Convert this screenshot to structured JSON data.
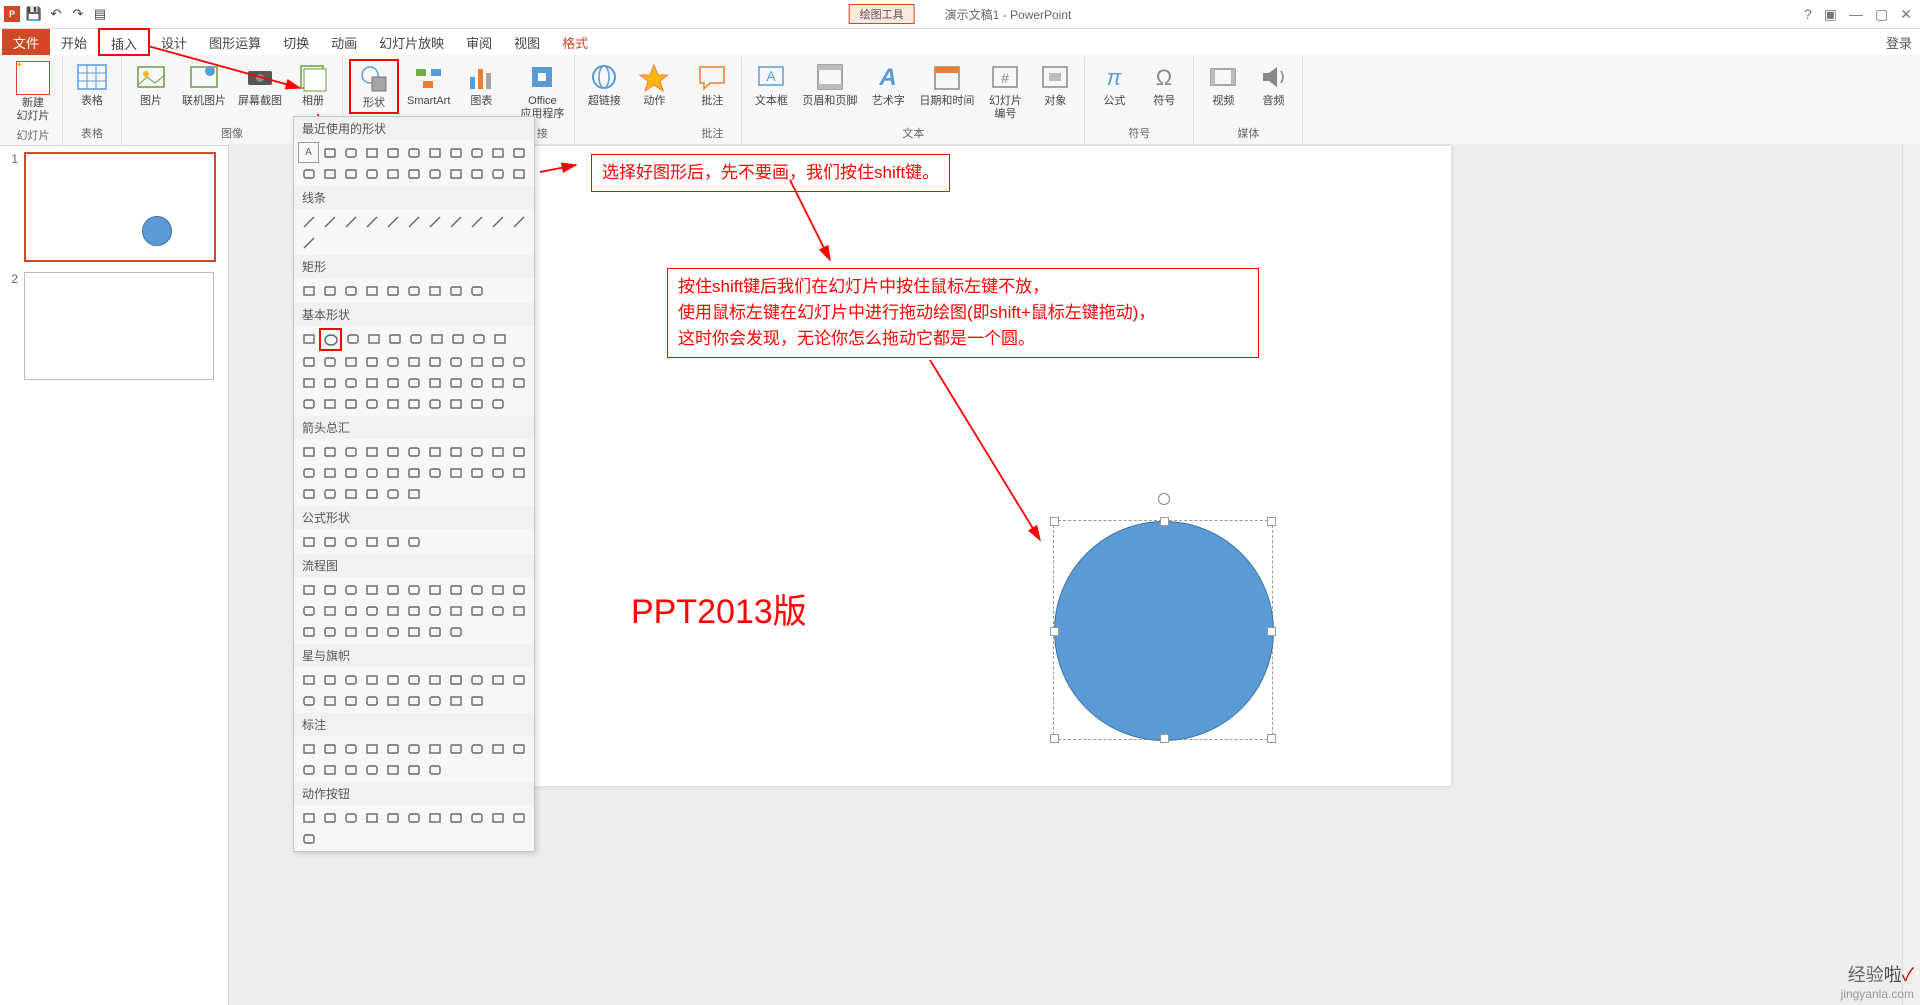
{
  "titlebar": {
    "contextual": "绘图工具",
    "doc_title": "演示文稿1 - PowerPoint",
    "help": "?"
  },
  "tabs": {
    "file": "文件",
    "home": "开始",
    "insert": "插入",
    "design": "设计",
    "tuxing": "图形运算",
    "transitions": "切换",
    "animations": "动画",
    "slideshow": "幻灯片放映",
    "review": "审阅",
    "view": "视图",
    "format": "格式",
    "login": "登录"
  },
  "ribbon": {
    "slides": {
      "new_slide": "新建\n幻灯片",
      "label": "幻灯片"
    },
    "tables": {
      "table": "表格",
      "label": "表格"
    },
    "images": {
      "picture": "图片",
      "online_pic": "联机图片",
      "screenshot": "屏幕截图",
      "album": "相册",
      "label": "图像"
    },
    "illustrations": {
      "shapes": "形状",
      "smartart": "SmartArt",
      "chart": "图表"
    },
    "apps": {
      "office_apps": "Office\n应用程序",
      "label": "接"
    },
    "links": {
      "hyperlink": "超链接",
      "action": "动作"
    },
    "comments": {
      "comment": "批注",
      "label": "批注"
    },
    "text": {
      "textbox": "文本框",
      "header_footer": "页眉和页脚",
      "wordart": "艺术字",
      "date_time": "日期和时间",
      "slide_num": "幻灯片\n编号",
      "object": "对象",
      "label": "文本"
    },
    "symbols": {
      "equation": "公式",
      "symbol": "符号",
      "label": "符号"
    },
    "media": {
      "video": "视频",
      "audio": "音频",
      "label": "媒体"
    }
  },
  "shape_dropdown": {
    "recent": "最近使用的形状",
    "lines": "线条",
    "rectangles": "矩形",
    "basic": "基本形状",
    "arrows": "箭头总汇",
    "equation": "公式形状",
    "flowchart": "流程图",
    "stars": "星与旗帜",
    "callouts": "标注",
    "action": "动作按钮"
  },
  "thumbs": {
    "s1": "1",
    "s2": "2"
  },
  "annotations": {
    "callout1": "选择好图形后，先不要画，我们按住shift键。",
    "callout2_l1": "按住shift键后我们在幻灯片中按住鼠标左键不放，",
    "callout2_l2": "使用鼠标左键在幻灯片中进行拖动绘图(即shift+鼠标左键拖动)，",
    "callout2_l3": "这时你会发现，无论你怎么拖动它都是一个圆。",
    "version": "PPT2013版"
  },
  "watermark": {
    "l1_a": "经验",
    "l1_b": "啦",
    "l1_c": "✓",
    "l2": "jingyanla.com"
  }
}
